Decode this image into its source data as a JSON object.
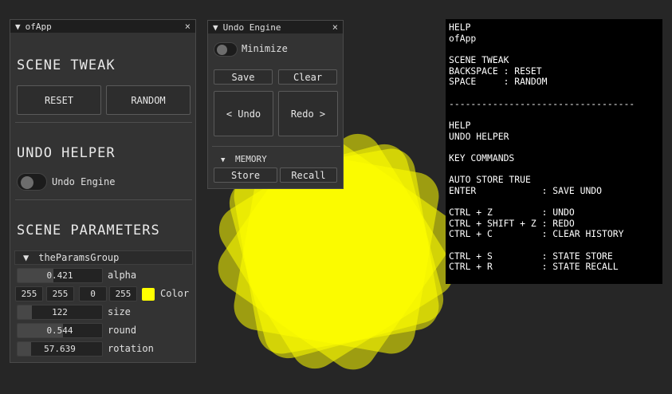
{
  "colors": {
    "background": "#262626",
    "shape_fill": "#ffff00"
  },
  "ofapp": {
    "title": "ofApp",
    "scene_tweak": {
      "title": "SCENE TWEAK",
      "reset_label": "RESET",
      "random_label": "RANDOM"
    },
    "undo_helper": {
      "title": "UNDO HELPER",
      "toggle_label": "Undo Engine",
      "toggle_on": false
    },
    "scene_parameters": {
      "title": "SCENE PARAMETERS",
      "group_label": "theParamsGroup",
      "alpha": {
        "value": "0.421",
        "label": "alpha"
      },
      "color": {
        "r": "255",
        "g": "255",
        "b": "0",
        "a": "255",
        "label": "Color",
        "swatch": "#ffff00"
      },
      "size": {
        "value": "122",
        "label": "size"
      },
      "round": {
        "value": "0.544",
        "label": "round"
      },
      "rotation": {
        "value": "57.639",
        "label": "rotation"
      }
    }
  },
  "undo_engine": {
    "title": "Undo Engine",
    "minimize_label": "Minimize",
    "save_label": "Save",
    "clear_label": "Clear",
    "undo_label": "< Undo",
    "redo_label": "Redo >",
    "memory_label": "MEMORY",
    "store_label": "Store",
    "recall_label": "Recall"
  },
  "help_text": "HELP\nofApp\n\nSCENE TWEAK\nBACKSPACE : RESET\nSPACE     : RANDOM\n\n----------------------------------\n\nHELP\nUNDO HELPER\n\nKEY COMMANDS\n\nAUTO STORE TRUE\nENTER            : SAVE UNDO\n\nCTRL + Z         : UNDO\nCTRL + SHIFT + Z : REDO\nCTRL + C         : CLEAR HISTORY\n\nCTRL + S         : STATE STORE\nCTRL + R         : STATE RECALL"
}
